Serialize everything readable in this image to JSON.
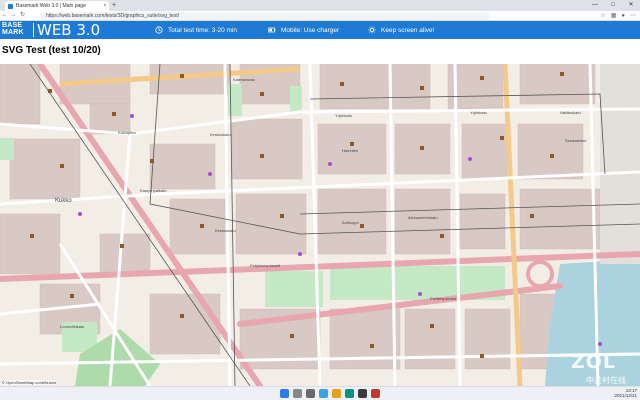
{
  "browser": {
    "tab_title": "Basemark Web 3.0 | Main page",
    "tab_close": "×",
    "new_tab": "+",
    "address": "https://web.basemark.com/tests/3D/graphics_suite/svg_test/",
    "back": "←",
    "forward": "→",
    "reload": "↻",
    "win_min": "—",
    "win_max": "□",
    "win_close": "✕"
  },
  "header": {
    "logo_line1": "BASE",
    "logo_line2": "MARK",
    "product": "WEB 3.0",
    "info_time": "Total test time: 3-20 min",
    "info_mobile": "Mobile: Use charger",
    "info_screen": "Keep screen alive!",
    "accent": "#1f7ad6"
  },
  "test": {
    "title": "SVG Test (test 10/20)"
  },
  "map": {
    "labels": {
      "kalevankatu": "Kalevankatu",
      "yrjonkatu": "Yrjönkatu",
      "yrjonkatu2": "Yrjönkatu",
      "hallituskatu": "Hallituskatu",
      "kampinpalkatu": "Kampinpalkatu",
      "hamnten": "Hamnten",
      "antikoppi": "Antikoppi",
      "pohjoisesplanadi": "Pohjoisesplanadi",
      "keskuskatu": "Keskuskatu",
      "keskuskatu2": "Keskuskatu",
      "kukko": "Kukko",
      "kaivopiha": "Kaivopiha",
      "aleksanterinkatu": "Aleksanterinkatu",
      "eteläesplanadi": "Eteläesplanadi",
      "lonnrotinkatu": "Lönnrotinkatu",
      "senaatintori": "Senaatintori"
    },
    "attribution": "© OpenStreetMap contributors"
  },
  "taskbar": {
    "time": "13:17",
    "date": "2021/12/21"
  },
  "watermark": {
    "text": "ZOL",
    "sub": "中关村在线"
  }
}
